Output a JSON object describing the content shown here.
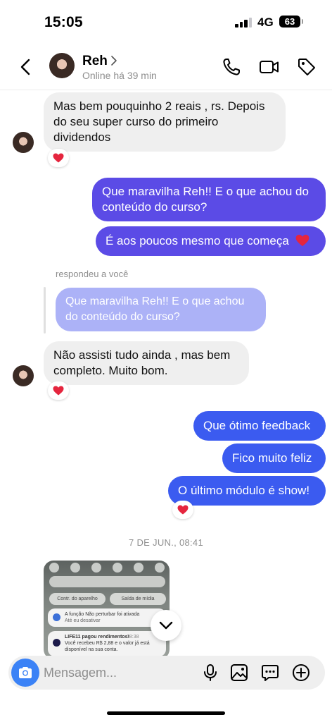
{
  "status_bar": {
    "time": "15:05",
    "network": "4G",
    "battery": "63"
  },
  "header": {
    "name": "Reh",
    "presence": "Online há 39 min"
  },
  "messages": {
    "m1": "Mas bem pouquinho 2 reais , rs. Depois do seu super curso do primeiro dividendos",
    "m2": "Que maravilha Reh!! E o que achou do conteúdo do curso?",
    "m3": "É aos poucos mesmo que começa",
    "reply_label": "respondeu a você",
    "quoted": "Que maravilha Reh!! E o que achou do conteúdo do curso?",
    "m4": "Não assisti tudo ainda , mas bem completo. Muito bom.",
    "m5": "Que ótimo feedback",
    "m6": "Fico muito feliz",
    "m7": "O último módulo é show!",
    "date": "7 DE JUN., 08:41"
  },
  "shared_image": {
    "btn_left": "Contr. do aparelho",
    "btn_right": "Saída de mídia",
    "n1_line1": "A função Não perturbar foi ativada",
    "n1_line2": "Até eu desativar",
    "n2_title": "LIFE11 pagou rendimentos!",
    "n2_time": "08:38",
    "n2_line1": "Você recebeu R$ 2,88 e o valor já está",
    "n2_line2": "disponível na sua conta."
  },
  "composer": {
    "placeholder": "Mensagem..."
  },
  "colors": {
    "outgoing_purple": "#5b4be6",
    "outgoing_blue": "#3b5bf0",
    "incoming": "#efefef",
    "heart": "#e5253e"
  }
}
